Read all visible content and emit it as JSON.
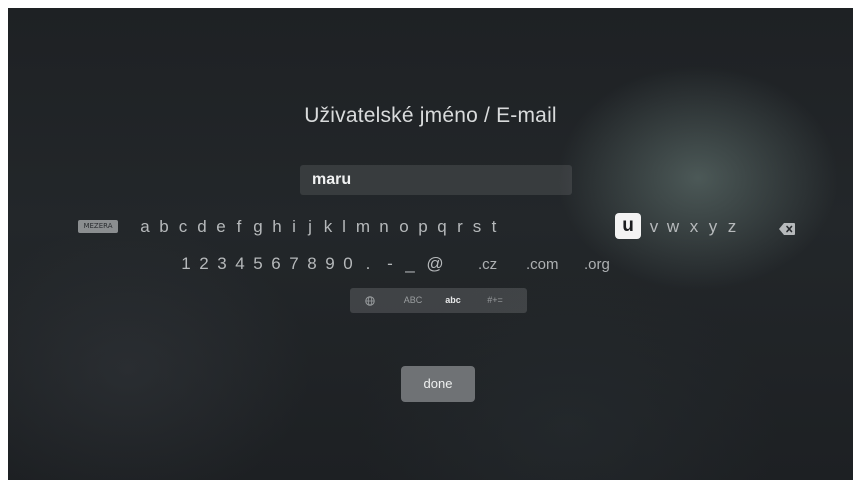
{
  "screen": {
    "title": "Uživatelské jméno / E-mail"
  },
  "input": {
    "value": "maru"
  },
  "keyboard": {
    "language_key": "MEZERA",
    "letters": [
      "a",
      "b",
      "c",
      "d",
      "e",
      "f",
      "g",
      "h",
      "i",
      "j",
      "k",
      "l",
      "m",
      "n",
      "o",
      "p",
      "q",
      "r",
      "s",
      "t",
      "u",
      "v",
      "w",
      "x",
      "y",
      "z"
    ],
    "focused_letter": "u",
    "backspace_icon": "backspace-icon",
    "numbers_symbols": [
      "1",
      "2",
      "3",
      "4",
      "5",
      "6",
      "7",
      "8",
      "9",
      "0",
      ".",
      "-",
      "_",
      "@"
    ],
    "domains": [
      ".cz",
      ".com",
      ".org"
    ],
    "modes": {
      "globe_icon": "globe-icon",
      "upper": "ABC",
      "lower": "abc",
      "symbols": "#+="
    },
    "active_mode": "abc"
  },
  "done_button": {
    "label": "done"
  },
  "colors": {
    "background": "#202326",
    "focused_key": "#f3f3f3",
    "done_button": "#6f7275"
  }
}
